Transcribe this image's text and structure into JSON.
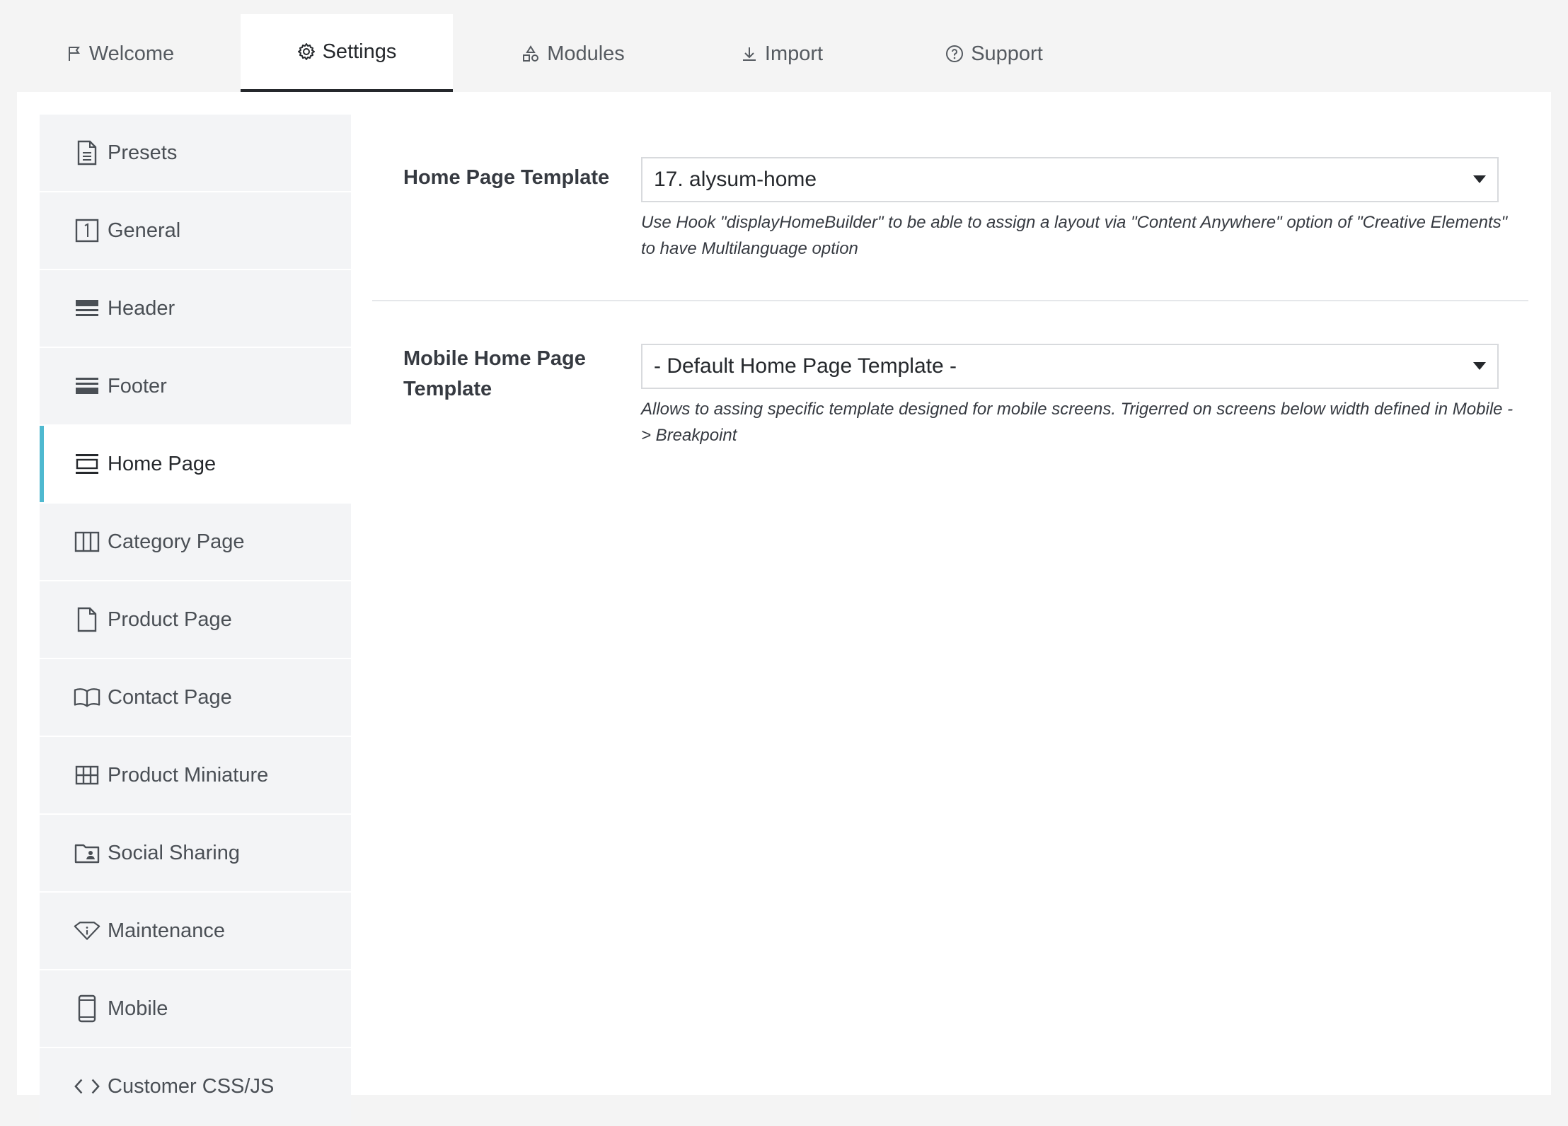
{
  "tabs": [
    {
      "label": "Welcome",
      "icon": "flag-icon"
    },
    {
      "label": "Settings",
      "icon": "gear-icon",
      "active": true
    },
    {
      "label": "Modules",
      "icon": "shapes-icon"
    },
    {
      "label": "Import",
      "icon": "download-icon"
    },
    {
      "label": "Support",
      "icon": "help-circle-icon"
    }
  ],
  "sidebar": {
    "items": [
      {
        "label": "Presets",
        "icon": "document-icon"
      },
      {
        "label": "General",
        "icon": "number-one-icon"
      },
      {
        "label": "Header",
        "icon": "header-layout-icon"
      },
      {
        "label": "Footer",
        "icon": "footer-layout-icon"
      },
      {
        "label": "Home Page",
        "icon": "home-layout-icon",
        "active": true
      },
      {
        "label": "Category Page",
        "icon": "columns-icon"
      },
      {
        "label": "Product Page",
        "icon": "file-icon"
      },
      {
        "label": "Contact Page",
        "icon": "book-icon"
      },
      {
        "label": "Product Miniature",
        "icon": "grid-icon"
      },
      {
        "label": "Social Sharing",
        "icon": "folder-user-icon"
      },
      {
        "label": "Maintenance",
        "icon": "diamond-info-icon"
      },
      {
        "label": "Mobile",
        "icon": "mobile-icon"
      },
      {
        "label": "Customer CSS/JS",
        "icon": "code-icon"
      }
    ]
  },
  "form": {
    "home_template": {
      "label": "Home Page Template",
      "value": "17. alysum-home",
      "help": "Use Hook \"displayHomeBuilder\" to be able to assign a layout via \"Content Anywhere\" option of \"Creative Elements\" to have Multilanguage option"
    },
    "mobile_template": {
      "label": "Mobile Home Page Template",
      "value": "- Default Home Page Template -",
      "help": "Allows to assing specific template designed for mobile screens. Trigerred on screens below width defined in Mobile -> Breakpoint"
    }
  },
  "colors": {
    "accent": "#4fb9d0",
    "active_tab_border": "#25282c",
    "sidebar_bg": "#f3f4f6",
    "page_bg": "#f4f4f4"
  }
}
